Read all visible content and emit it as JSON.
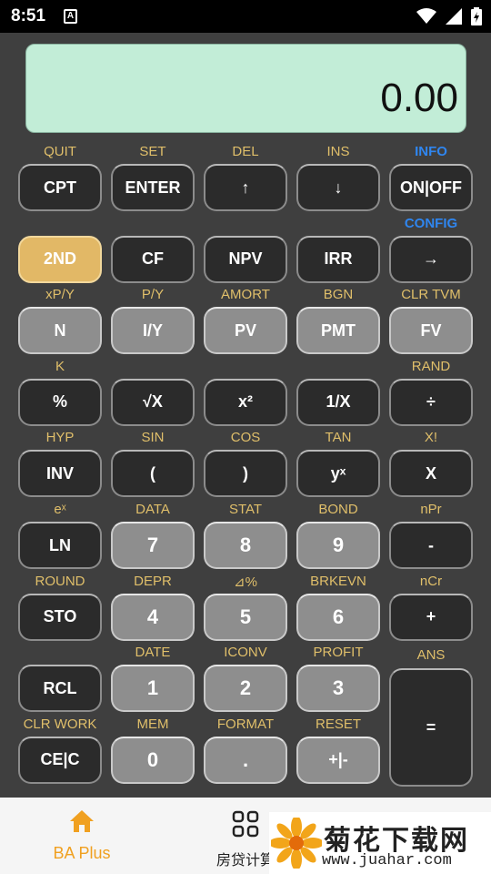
{
  "status_bar": {
    "time": "8:51",
    "notification": "A"
  },
  "display": {
    "value": "0.00"
  },
  "rows": [
    [
      {
        "sub": "QUIT",
        "label": "CPT",
        "style": "dark"
      },
      {
        "sub": "SET",
        "label": "ENTER",
        "style": "dark"
      },
      {
        "sub": "DEL",
        "label": "↑",
        "style": "dark"
      },
      {
        "sub": "INS",
        "label": "↓",
        "style": "dark"
      },
      {
        "sub": "INFO",
        "label": "ON|OFF",
        "style": "dark",
        "subBlue": true
      }
    ],
    [
      {
        "sub": "",
        "label": "2ND",
        "style": "gold"
      },
      {
        "sub": "",
        "label": "CF",
        "style": "dark"
      },
      {
        "sub": "",
        "label": "NPV",
        "style": "dark"
      },
      {
        "sub": "",
        "label": "IRR",
        "style": "dark"
      },
      {
        "sub": "CONFIG",
        "label": "→",
        "style": "dark",
        "subBlue": true
      }
    ],
    [
      {
        "sub": "xP/Y",
        "label": "N",
        "style": "gray"
      },
      {
        "sub": "P/Y",
        "label": "I/Y",
        "style": "gray"
      },
      {
        "sub": "AMORT",
        "label": "PV",
        "style": "gray"
      },
      {
        "sub": "BGN",
        "label": "PMT",
        "style": "gray"
      },
      {
        "sub": "CLR TVM",
        "label": "FV",
        "style": "gray"
      }
    ],
    [
      {
        "sub": "K",
        "label": "%",
        "style": "dark"
      },
      {
        "sub": "",
        "label": "√X",
        "style": "dark"
      },
      {
        "sub": "",
        "label": "x²",
        "style": "dark"
      },
      {
        "sub": "",
        "label": "1/X",
        "style": "dark"
      },
      {
        "sub": "RAND",
        "label": "÷",
        "style": "dark"
      }
    ],
    [
      {
        "sub": "HYP",
        "label": "INV",
        "style": "dark"
      },
      {
        "sub": "SIN",
        "label": "(",
        "style": "dark"
      },
      {
        "sub": "COS",
        "label": ")",
        "style": "dark"
      },
      {
        "sub": "TAN",
        "label": "yˣ",
        "style": "dark"
      },
      {
        "sub": "X!",
        "label": "X",
        "style": "dark"
      }
    ],
    [
      {
        "sub": "eˣ",
        "label": "LN",
        "style": "dark"
      },
      {
        "sub": "DATA",
        "label": "7",
        "style": "gray"
      },
      {
        "sub": "STAT",
        "label": "8",
        "style": "gray"
      },
      {
        "sub": "BOND",
        "label": "9",
        "style": "gray"
      },
      {
        "sub": "nPr",
        "label": "-",
        "style": "dark"
      }
    ],
    [
      {
        "sub": "ROUND",
        "label": "STO",
        "style": "dark"
      },
      {
        "sub": "DEPR",
        "label": "4",
        "style": "gray"
      },
      {
        "sub": "⊿%",
        "label": "5",
        "style": "gray"
      },
      {
        "sub": "BRKEVN",
        "label": "6",
        "style": "gray"
      },
      {
        "sub": "nCr",
        "label": "+",
        "style": "dark"
      }
    ],
    [
      {
        "sub": "",
        "label": "RCL",
        "style": "dark"
      },
      {
        "sub": "DATE",
        "label": "1",
        "style": "gray"
      },
      {
        "sub": "ICONV",
        "label": "2",
        "style": "gray"
      },
      {
        "sub": "PROFIT",
        "label": "3",
        "style": "gray"
      },
      {
        "sub": "ANS",
        "label": "=",
        "style": "dark",
        "tall": true
      }
    ],
    [
      {
        "sub": "CLR WORK",
        "label": "CE|C",
        "style": "dark"
      },
      {
        "sub": "MEM",
        "label": "0",
        "style": "gray"
      },
      {
        "sub": "FORMAT",
        "label": ".",
        "style": "gray"
      },
      {
        "sub": "RESET",
        "label": "+|-",
        "style": "gray"
      }
    ]
  ],
  "bottom_nav": {
    "tab1_label": "BA Plus",
    "tab2_label": "房贷计算"
  },
  "watermark": {
    "brand": "菊花下载网",
    "url": "www.juahar.com"
  },
  "colors": {
    "accent": "#e2b866",
    "sub_label": "#e0bf6a",
    "info_blue": "#2f86f0",
    "display_bg": "#c2edd7",
    "tab_active": "#f0a020"
  }
}
